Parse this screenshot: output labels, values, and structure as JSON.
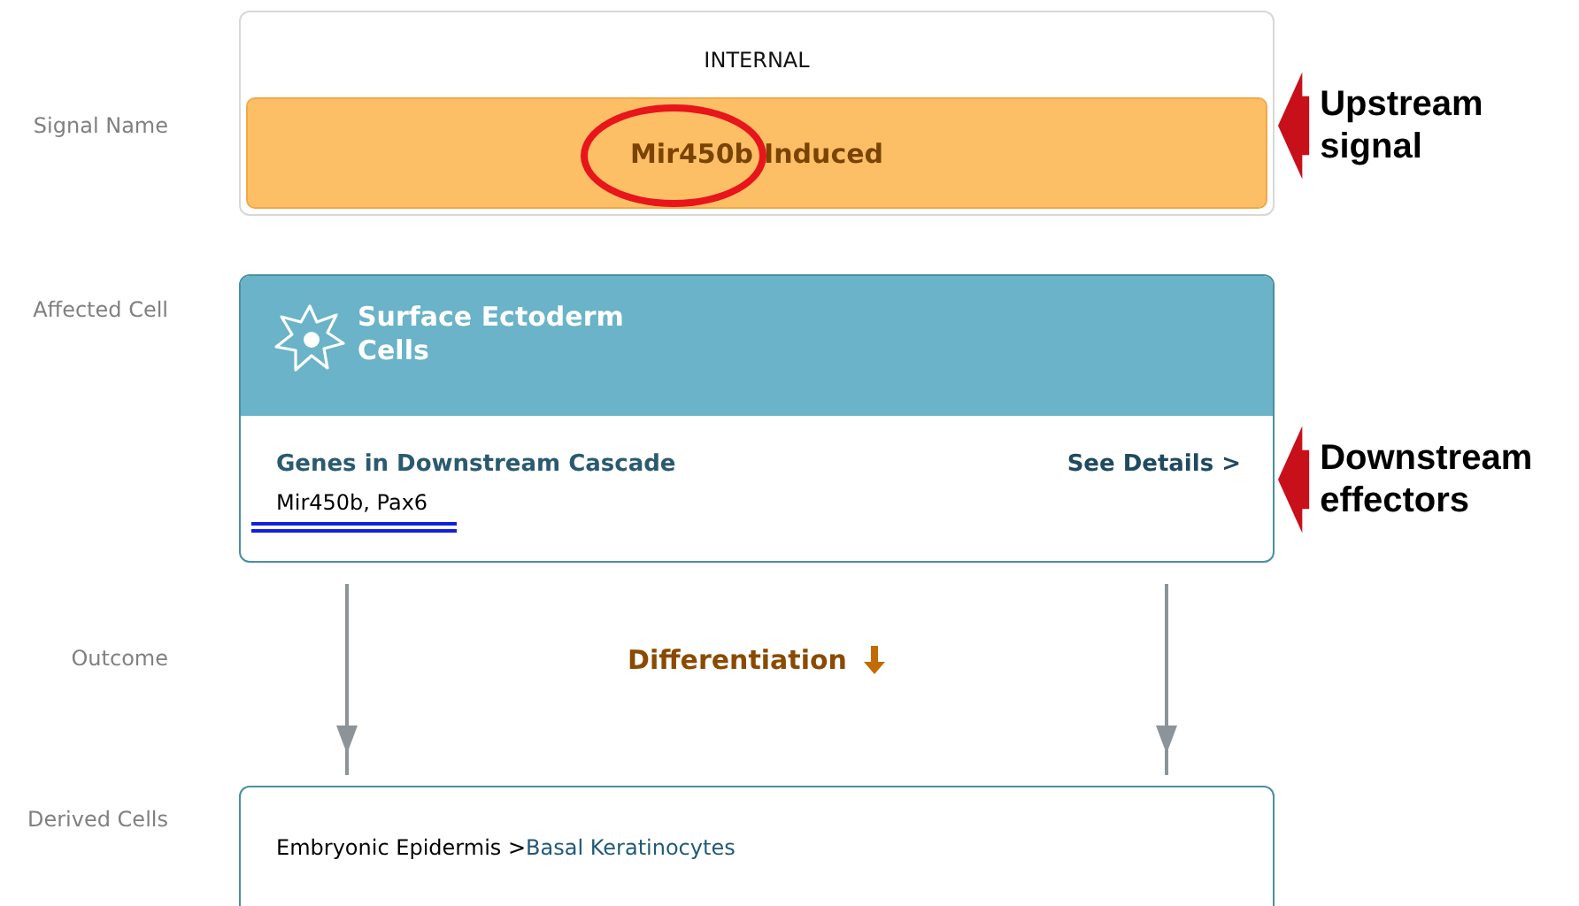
{
  "signal": {
    "label": "Signal Name",
    "category": "INTERNAL",
    "name_parts": [
      {
        "text": "Mir450b",
        "circled": true
      },
      {
        "text": "Induced",
        "circled": false
      }
    ],
    "annotation": "Upstream signal"
  },
  "affected_cell": {
    "label": "Affected Cell",
    "title": "Surface Ectoderm Cells",
    "genes_heading": "Genes in Downstream Cascade",
    "details_link": "See Details >",
    "genes": {
      "text": "Mir450b, Pax6",
      "underlined": true
    },
    "annotation": "Downstream effectors"
  },
  "outcome": {
    "label": "Outcome",
    "text": "Differentiation"
  },
  "derived_cells": {
    "label": "Derived Cells",
    "lineage": "Embryonic Epidermis >",
    "cell": "Basal Keratinocytes"
  }
}
